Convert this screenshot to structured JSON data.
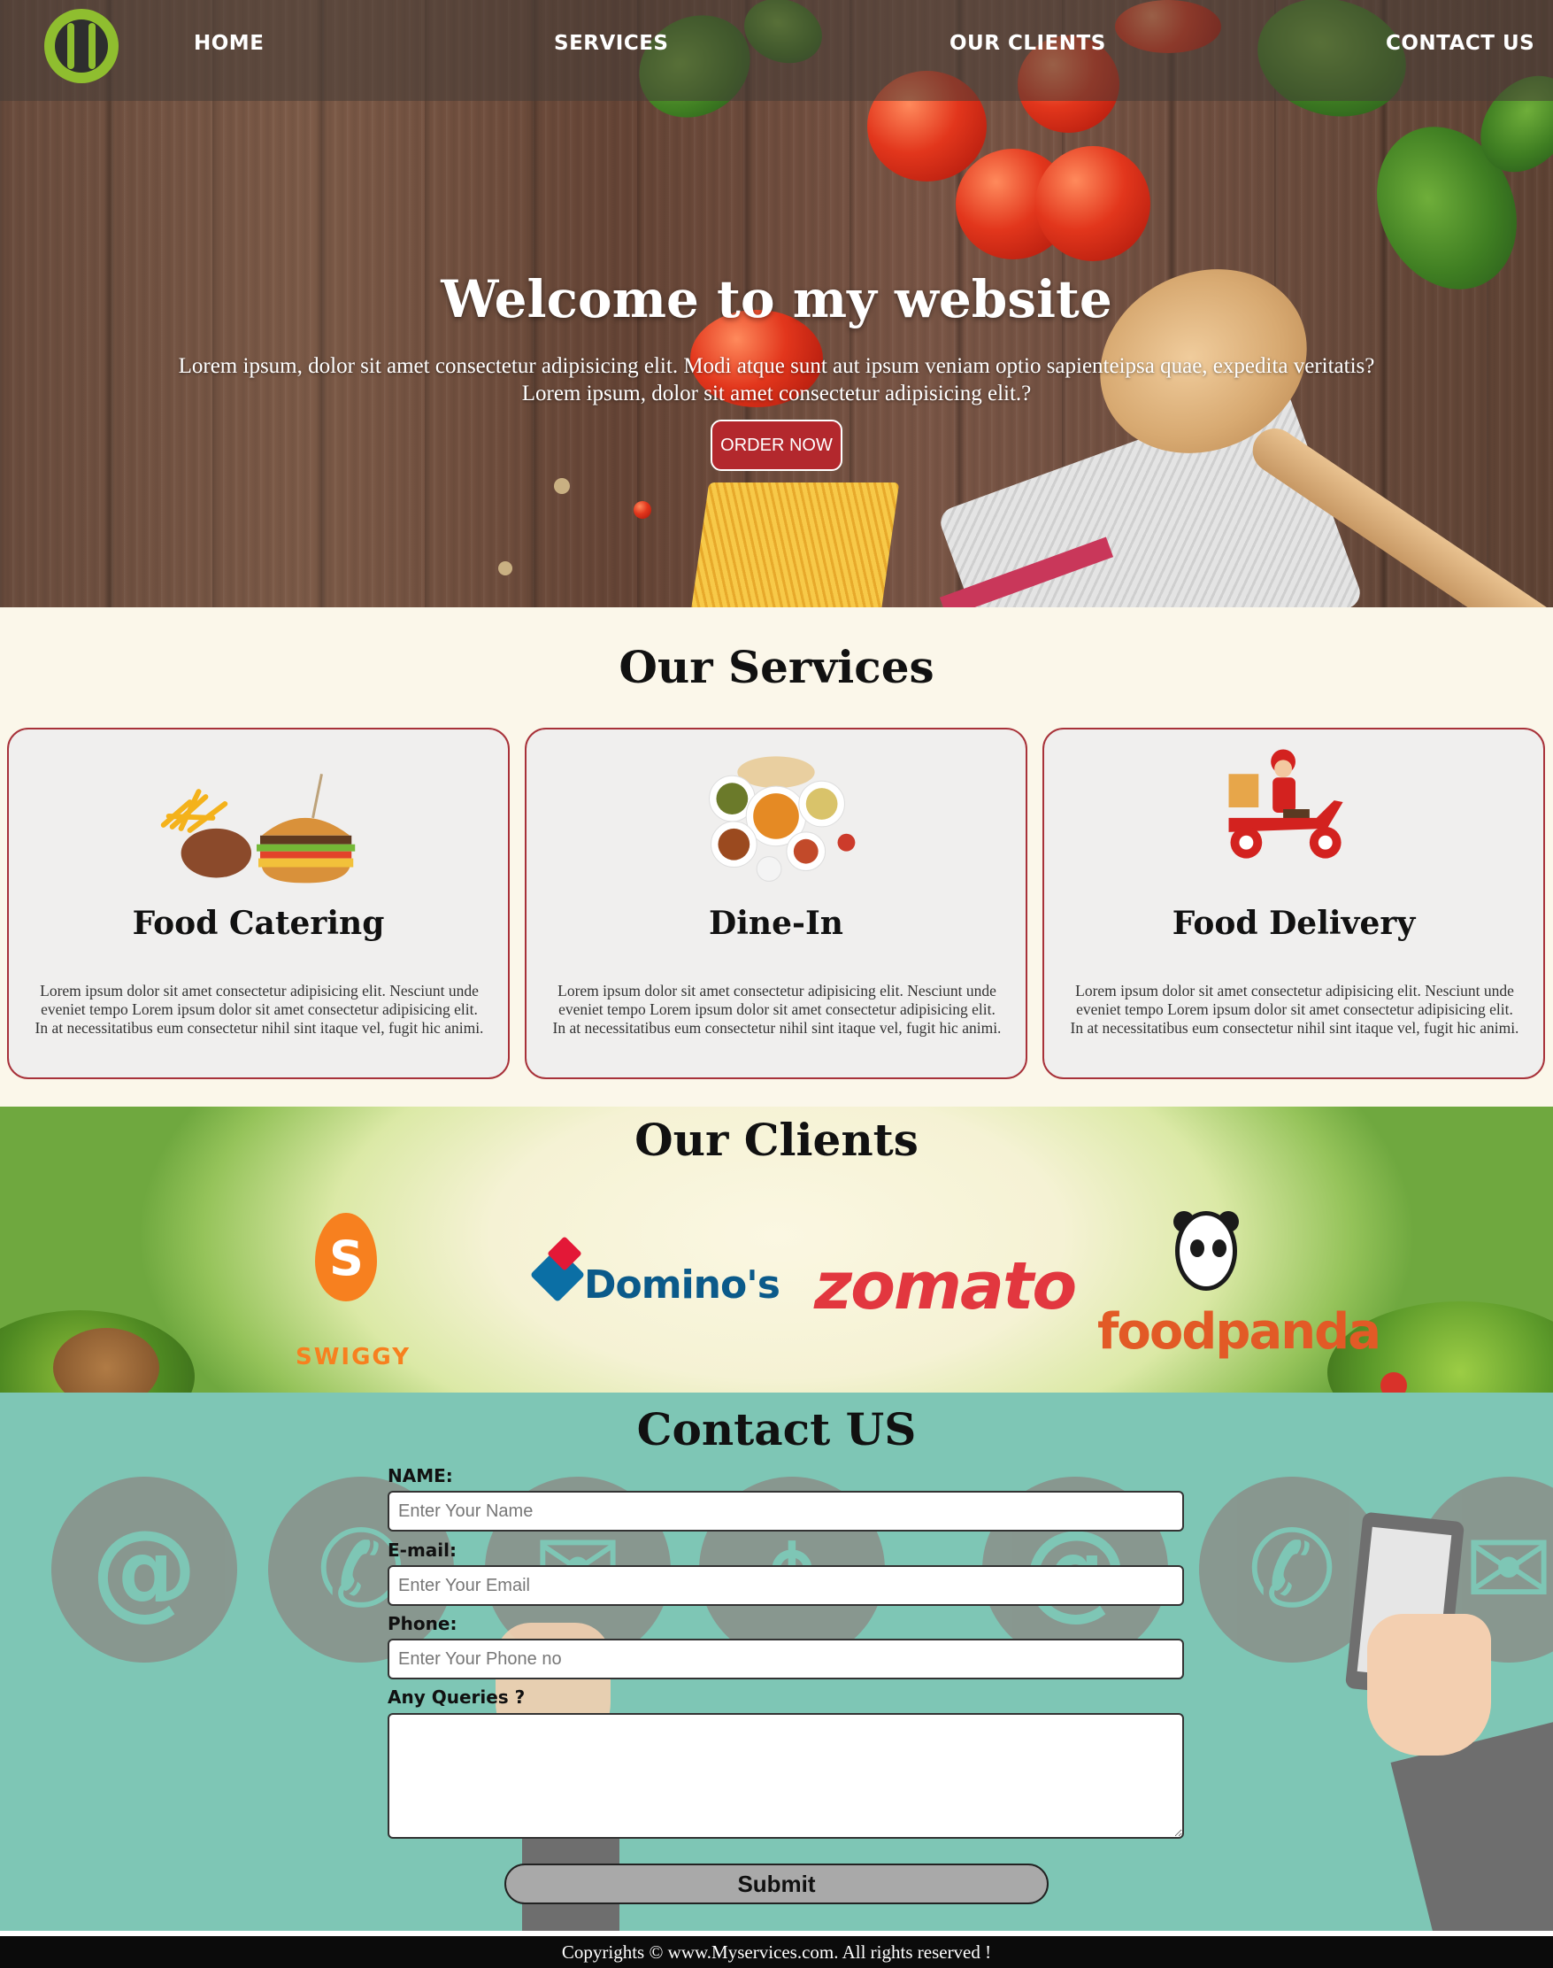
{
  "nav": {
    "items": [
      {
        "label": "HOME"
      },
      {
        "label": "SERVICES"
      },
      {
        "label": "OUR CLIENTS"
      },
      {
        "label": "CONTACT US"
      }
    ]
  },
  "hero": {
    "title": "Welcome to my website",
    "line1": "Lorem ipsum, dolor sit amet consectetur adipisicing elit. Modi atque sunt aut ipsum veniam optio sapienteipsa quae, expedita veritatis?",
    "line2": "Lorem ipsum, dolor sit amet consectetur adipisicing elit.?",
    "button": "ORDER NOW"
  },
  "services": {
    "title": "Our Services",
    "cards": [
      {
        "title": "Food Catering",
        "text": "Lorem ipsum dolor sit amet consectetur adipisicing elit. Nesciunt unde eveniet tempo Lorem ipsum dolor sit amet consectetur adipisicing elit. In at necessitatibus eum consectetur nihil sint itaque vel, fugit hic animi.",
        "icon": "burger-fries-icon"
      },
      {
        "title": "Dine-In",
        "text": "Lorem ipsum dolor sit amet consectetur adipisicing elit. Nesciunt unde eveniet tempo Lorem ipsum dolor sit amet consectetur adipisicing elit. In at necessitatibus eum consectetur nihil sint itaque vel, fugit hic animi.",
        "icon": "dishes-icon"
      },
      {
        "title": "Food Delivery",
        "text": "Lorem ipsum dolor sit amet consectetur adipisicing elit. Nesciunt unde eveniet tempo Lorem ipsum dolor sit amet consectetur adipisicing elit. In at necessitatibus eum consectetur nihil sint itaque vel, fugit hic animi.",
        "icon": "delivery-scooter-icon"
      }
    ]
  },
  "clients": {
    "title": "Our Clients",
    "logos": [
      {
        "name": "SWIGGY",
        "mark": "S"
      },
      {
        "name": "Domino's"
      },
      {
        "name": "zomato"
      },
      {
        "name": "foodpanda"
      }
    ]
  },
  "contact": {
    "title": "Contact US",
    "name_label": "NAME:",
    "name_placeholder": "Enter Your Name",
    "email_label": "E-mail:",
    "email_placeholder": "Enter Your Email",
    "phone_label": "Phone:",
    "phone_placeholder": "Enter Your Phone no",
    "query_label": "Any Queries ?",
    "submit": "Submit",
    "bg_symbols": [
      "@",
      "✆",
      "✉",
      "⌖",
      "@",
      "✆",
      "✉"
    ]
  },
  "footer": {
    "text": "Copyrights © www.Myservices.com. All rights reserved !"
  },
  "colors": {
    "accent": "#b3282d",
    "card_border": "#a8323a",
    "contact_bg": "#7ec6b5",
    "logo_green": "#8fbe2f"
  }
}
